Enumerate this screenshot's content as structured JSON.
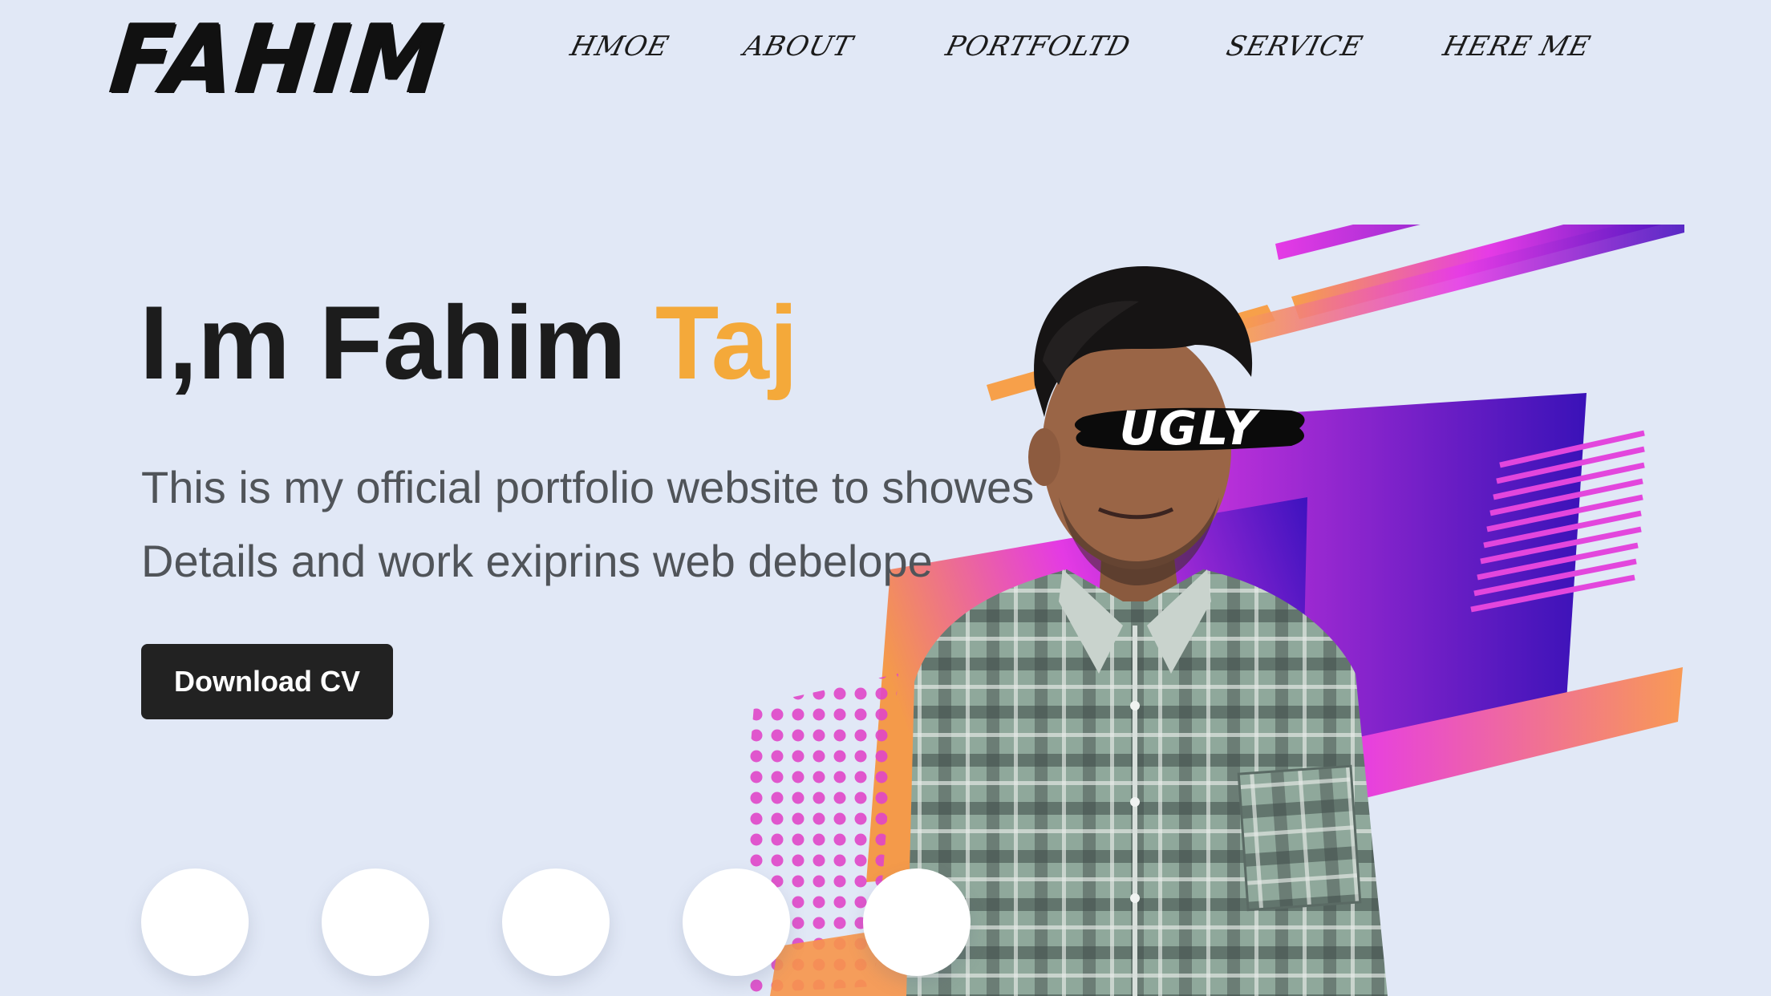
{
  "brand": {
    "logo_text": "FAHIM"
  },
  "nav": {
    "items": [
      {
        "label": "HMOE"
      },
      {
        "label": "ABOUT"
      },
      {
        "label": "PORTFOLTD"
      },
      {
        "label": "SERVICE"
      },
      {
        "label": "HERE ME"
      }
    ]
  },
  "hero": {
    "title_prefix": "I,m Fahim ",
    "title_accent": "Taj",
    "description_line1": "This is my official portfolio website to showes",
    "description_line2": "Details and work exiprins web debelope",
    "cta_label": "Download CV",
    "overlay_label": "UGLY"
  },
  "social": {
    "icons": [
      "social-icon-1",
      "social-icon-2",
      "social-icon-3",
      "social-icon-4",
      "social-icon-5"
    ]
  },
  "colors": {
    "background": "#e1e8f6",
    "accent": "#f4a93a",
    "text_dark": "#1c1c1c",
    "text_muted": "#505459",
    "button_bg": "#222222",
    "gradient_magenta": "#e63be6",
    "gradient_purple": "#5a12c8",
    "gradient_orange": "#f7a04a"
  }
}
